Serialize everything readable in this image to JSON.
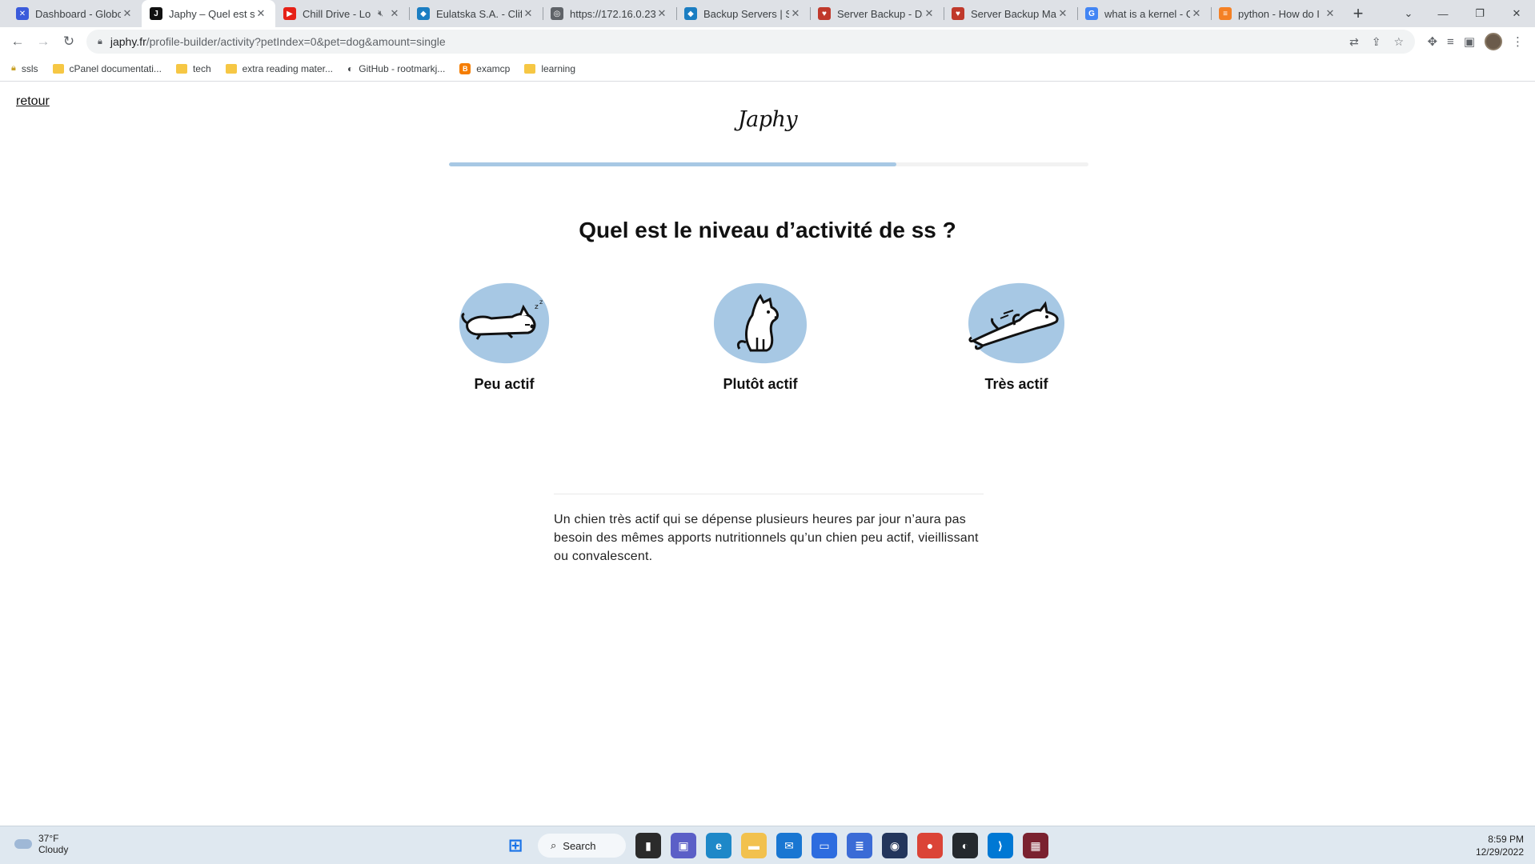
{
  "browser": {
    "tabs": [
      {
        "title": "Dashboard - Globo",
        "favicon_color": "#3b5bdb",
        "glyph": "✕"
      },
      {
        "title": "Japhy – Quel est so",
        "favicon_color": "#111111",
        "glyph": "J"
      },
      {
        "title": "Chill Drive - Lo",
        "favicon_color": "#e62117",
        "glyph": "▶",
        "muted": true
      },
      {
        "title": "Eulatska S.A. - Clif",
        "favicon_color": "#1b7ec2",
        "glyph": "◆"
      },
      {
        "title": "https://172.16.0.23",
        "favicon_color": "#5f6368",
        "glyph": "◎"
      },
      {
        "title": "Backup Servers | Su",
        "favicon_color": "#1b7ec2",
        "glyph": "◆"
      },
      {
        "title": "Server Backup - Da",
        "favicon_color": "#c0392b",
        "glyph": "♥"
      },
      {
        "title": "Server Backup Man",
        "favicon_color": "#c0392b",
        "glyph": "♥"
      },
      {
        "title": "what is a kernel - G",
        "favicon_color": "#4285f4",
        "glyph": "G"
      },
      {
        "title": "python - How do I",
        "favicon_color": "#f48024",
        "glyph": "≡"
      }
    ],
    "active_tab": 1,
    "new_tab_label": "+",
    "url_host": "japhy.fr",
    "url_path": "/profile-builder/activity?petIndex=0&pet=dog&amount=single",
    "bookmarks": [
      {
        "label": "ssls",
        "icon": "lock-icon"
      },
      {
        "label": "cPanel documentati...",
        "icon": "folder-icon"
      },
      {
        "label": "tech",
        "icon": "folder-icon"
      },
      {
        "label": "extra reading mater...",
        "icon": "folder-icon"
      },
      {
        "label": "GitHub - rootmarkj...",
        "icon": "github-icon"
      },
      {
        "label": "examcp",
        "icon": "blogger-icon"
      },
      {
        "label": "learning",
        "icon": "folder-icon"
      }
    ]
  },
  "page": {
    "back_label": "retour",
    "logo": "Japhy",
    "progress": 0.7,
    "question": "Quel est le niveau d’activité de ss ?",
    "options": [
      {
        "label": "Peu actif",
        "icon": "sleeping-dog-icon"
      },
      {
        "label": "Plutôt actif",
        "icon": "sitting-dog-icon"
      },
      {
        "label": "Très actif",
        "icon": "running-dog-icon"
      }
    ],
    "info_text": "Un chien très actif qui se dépense plusieurs heures par jour n’aura pas besoin des mêmes apports nutritionnels qu’un chien peu actif, vieillissant ou convalescent.",
    "accent_color": "#a7c8e4"
  },
  "taskbar": {
    "temperature": "37°F",
    "weather": "Cloudy",
    "search_label": "Search",
    "time": "8:59 PM",
    "date": "12/29/2022"
  }
}
